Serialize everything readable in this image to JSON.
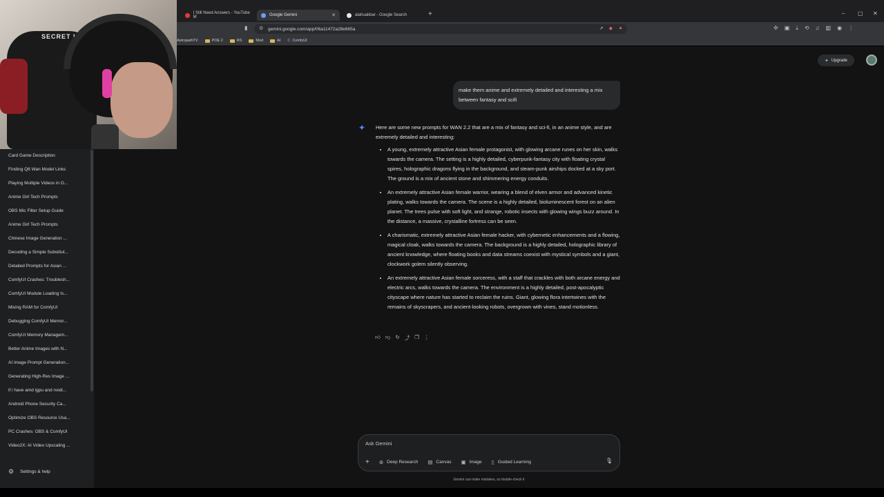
{
  "browser": {
    "tabs": [
      {
        "title": "I Still Need Answers - YouTube M",
        "active": false
      },
      {
        "title": "Google Gemini",
        "active": true
      },
      {
        "title": "alahuakbar - Google Search",
        "active": false
      }
    ],
    "url": "gemini.google.com/app/06a11472a28e665a",
    "bookmarks": [
      "AstropathTV",
      "POE 2",
      "RS",
      "Mod",
      "AI",
      "ComfyUI"
    ]
  },
  "sidebar": {
    "recent": [
      "Card Game Description",
      "Finding Q8 Wan Model Links",
      "Playing Multiple Videos in O...",
      "Anime Girl Tech Prompts",
      "OBS Mic Filter Setup Guide",
      "Anime Girl Tech Prompts",
      "Chinese Image Generation ...",
      "Decoding a Simple Substitut...",
      "Detailed Prompts for Asian ...",
      "ComfyUI Crashes: Troublesh...",
      "ComfyUI Module Loading Is...",
      "Mixing RAM for ComfyUI",
      "Debugging ComfyUI Memor...",
      "ComfyUI Memory Managem...",
      "Better Anime Images with N...",
      "AI Image Prompt Generation...",
      "Generating High-Res Image ...",
      "if i have amd igpu and nvidi...",
      "Android Phone Security Ca...",
      "Optimize OBS Resource Usa...",
      "PC Crashes: OBS & ComfyUI",
      "Video2X: AI Video Upscaling ..."
    ],
    "settings_label": "Settings & help"
  },
  "header": {
    "upgrade_label": "Upgrade"
  },
  "chat": {
    "user_message": "make them anime and extremely detailed and interesting a mix between fantasy and scifi",
    "response_intro": "Here are some new prompts for WAN 2.2 that are a mix of fantasy and sci-fi, in an anime style, and are extremely detailed and interesting:",
    "response_items": [
      "A young, extremely attractive Asian female protagonist, with glowing arcane runes on her skin, walks towards the camera. The setting is a highly detailed, cyberpunk-fantasy city with floating crystal spires, holographic dragons flying in the background, and steam-punk airships docked at a sky port. The ground is a mix of ancient stone and shimmering energy conduits.",
      "An extremely attractive Asian female warrior, wearing a blend of elven armor and advanced kinetic plating, walks towards the camera. The scene is a highly detailed, bioluminescent forest on an alien planet. The trees pulse with soft light, and strange, robotic insects with glowing wings buzz around. In the distance, a massive, crystalline fortress can be seen.",
      "A charismatic, extremely attractive Asian female hacker, with cybernetic enhancements and a flowing, magical cloak, walks towards the camera. The background is a highly detailed, holographic library of ancient knowledge, where floating books and data streams coexist with mystical symbols and a giant, clockwork golem silently observing.",
      "An extremely attractive Asian female sorceress, with a staff that crackles with both arcane energy and electric arcs, walks towards the camera. The environment is a highly detailed, post-apocalyptic cityscape where nature has started to reclaim the ruins. Giant, glowing flora intertwines with the remains of skyscrapers, and ancient-looking robots, overgrown with vines, stand motionless."
    ]
  },
  "composer": {
    "placeholder": "Ask Gemini",
    "tools": [
      "Deep Research",
      "Canvas",
      "Image",
      "Guided Learning"
    ],
    "disclaimer": "Gemini can make mistakes, so double-check it"
  },
  "webcam": {
    "chair_logo": "SECRET LAB"
  },
  "colors": {
    "accent": "#4f8ff7",
    "background": "#131314",
    "sidebar": "#1e1f20"
  }
}
